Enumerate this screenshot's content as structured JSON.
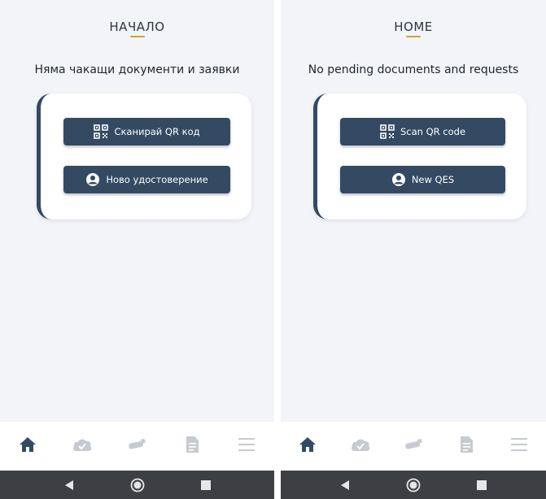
{
  "left": {
    "header_title": "НАЧАЛО",
    "message": "Няма чакащи документи и заявки",
    "scan_label": "Сканирай QR код",
    "new_label": "Ново удостоверение"
  },
  "right": {
    "header_title": "HOME",
    "message": "No pending documents and requests",
    "scan_label": "Scan QR code",
    "new_label": "New QES"
  },
  "tabbar": {
    "items": [
      {
        "icon": "home-icon",
        "active": true
      },
      {
        "icon": "cloud-check-icon",
        "active": false
      },
      {
        "icon": "usb-token-icon",
        "active": false
      },
      {
        "icon": "document-icon",
        "active": false
      },
      {
        "icon": "menu-icon",
        "active": false
      }
    ]
  },
  "navbar": {
    "items": [
      "back-icon",
      "home-circle-icon",
      "recents-icon"
    ]
  },
  "colors": {
    "accent": "#344a63",
    "underline": "#c9a23a",
    "background": "#f3f4f7",
    "active_tab": "#344a63",
    "inactive_tab": "#c7cacf"
  }
}
